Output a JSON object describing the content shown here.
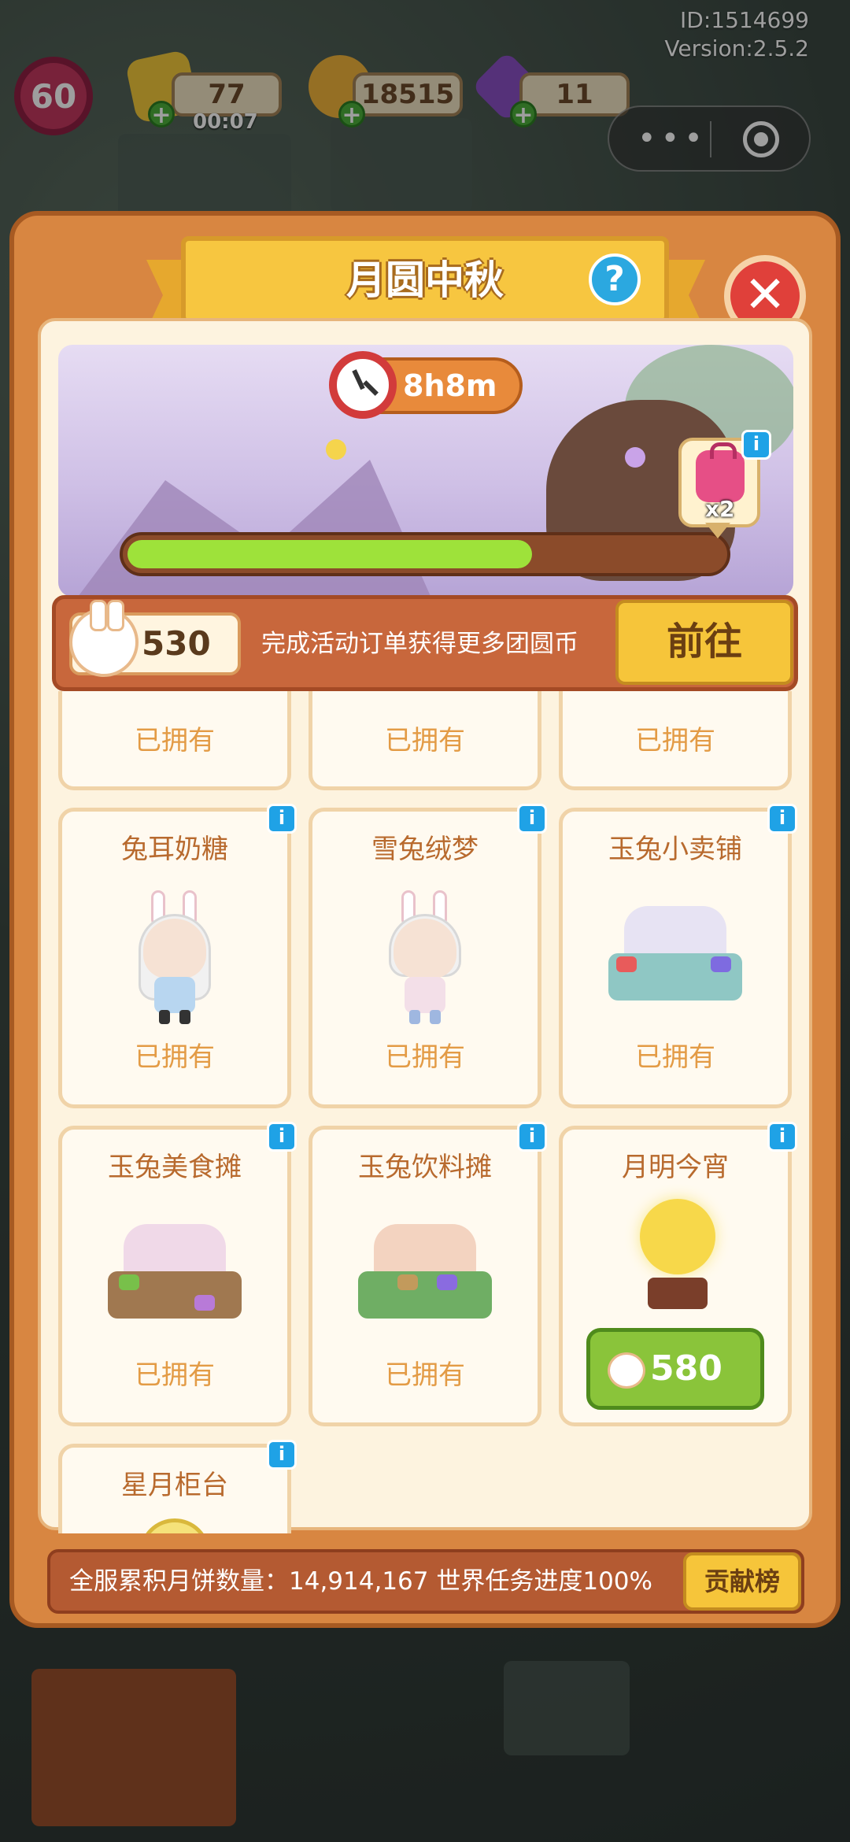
{
  "hud": {
    "id_line": "ID:1514699",
    "version_line": "Version:2.5.2",
    "level": "60",
    "energy": "77",
    "energy_timer": "00:07",
    "coins": "18515",
    "gems": "11",
    "menu_dots": "•••"
  },
  "modal": {
    "title": "月圆中秋",
    "help": "?",
    "close": "✕",
    "timer": "8h8m",
    "progress": 0.68,
    "reward_count": "x2",
    "coin_value": "530",
    "coin_desc": "完成活动订单获得更多团圆币",
    "go_label": "前往",
    "footer_text": "全服累积月饼数量：14,914,167  世界任务进度100%",
    "rank_label": "贡献榜"
  },
  "colors": {
    "banner": "#f7c640",
    "panel": "#d88641",
    "price_green": "#8ac43a",
    "progress": "#9ee23a"
  },
  "items": [
    {
      "name": "",
      "status": "已拥有"
    },
    {
      "name": "",
      "status": "已拥有"
    },
    {
      "name": "",
      "status": "已拥有"
    },
    {
      "name": "兔耳奶糖",
      "status": "已拥有",
      "art": "bunny-girl"
    },
    {
      "name": "雪兔绒梦",
      "status": "已拥有",
      "art": "bunny-boy"
    },
    {
      "name": "玉兔小卖铺",
      "status": "已拥有",
      "art": "rabbit-shop"
    },
    {
      "name": "玉兔美食摊",
      "status": "已拥有",
      "art": "food-stall"
    },
    {
      "name": "玉兔饮料摊",
      "status": "已拥有",
      "art": "drink-stall"
    },
    {
      "name": "月明今宵",
      "price": "580",
      "art": "moon-lamp"
    },
    {
      "name": "星月柜台",
      "art": "counter"
    }
  ]
}
